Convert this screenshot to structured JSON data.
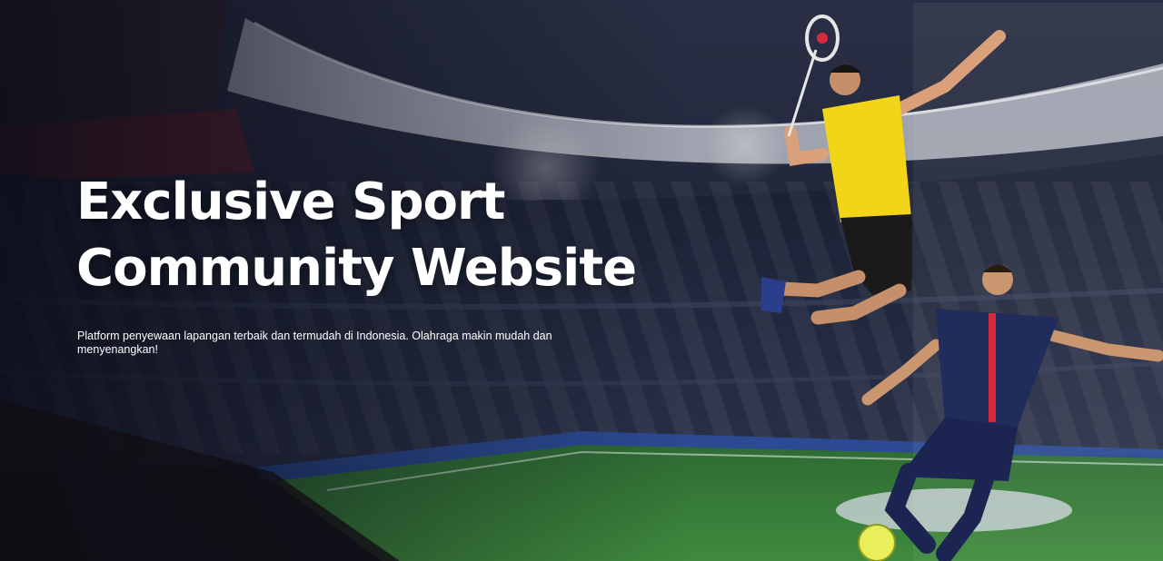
{
  "hero": {
    "title_line1": "Exclusive Sport",
    "title_line2": "Community Website",
    "subtitle": "Platform penyewaan lapangan terbaik dan termudah di Indonesia.  Olahraga makin mudah dan menyenangkan!"
  },
  "images": {
    "background": "stadium-photo",
    "athlete_one": "badminton-player-photo",
    "athlete_two": "footballer-photo"
  },
  "colors": {
    "text": "#ffffff",
    "pitch": "#2f6f30",
    "night_sky": "#1c2238",
    "badminton_shirt": "#f2d419",
    "football_shirt": "#1f2c5c",
    "shirt_stripe": "#d7283a"
  }
}
